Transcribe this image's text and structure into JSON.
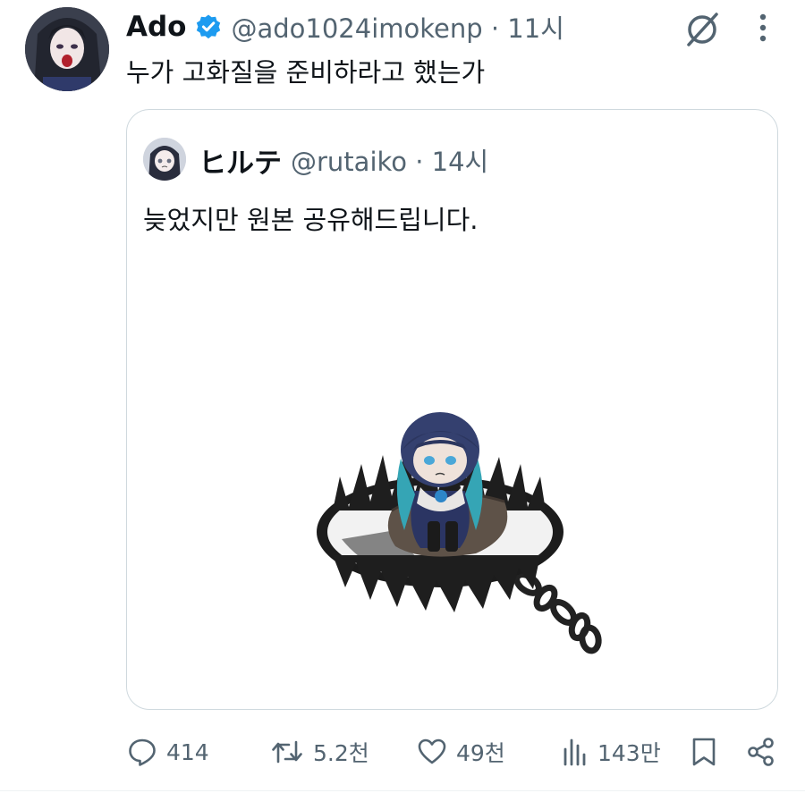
{
  "tweet": {
    "author_name": "Ado",
    "handle_time": "@ado1024imokenp · 11시",
    "text": "누가 고화질을 준비하라고 했는가"
  },
  "quote": {
    "author_name": "ヒルテ",
    "handle_time": "@rutaiko · 14시",
    "text": "늦었지만 원본 공유해드립니다."
  },
  "actions": {
    "reply_count": "414",
    "retweet_count": "5.2천",
    "like_count": "49천",
    "view_count": "143만"
  },
  "icons": {
    "verified": "verified-badge-icon",
    "grok": "grok-icon",
    "more": "more-vertical-icon",
    "reply": "reply-icon",
    "retweet": "retweet-icon",
    "like": "like-icon",
    "views": "views-icon",
    "bookmark": "bookmark-icon",
    "share": "share-icon"
  },
  "colors": {
    "verified": "#1d9bf0",
    "text_primary": "#0f1419",
    "text_secondary": "#536471",
    "border": "#cfd9de"
  }
}
